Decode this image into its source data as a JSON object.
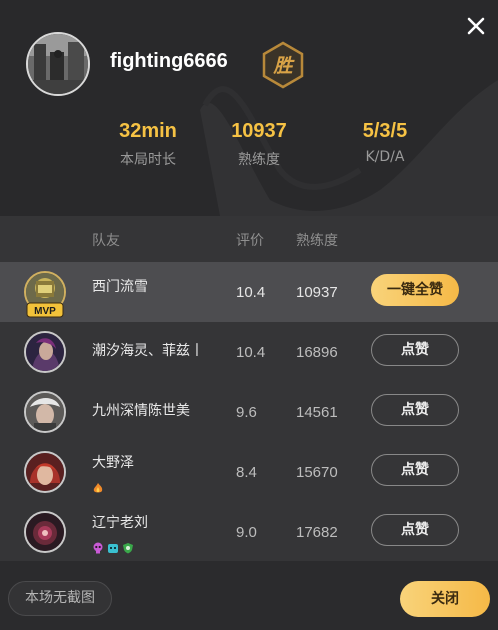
{
  "header": {
    "username": "fighting6666",
    "result_badge": "胜",
    "stats": [
      {
        "value": "32min",
        "label": "本局时长"
      },
      {
        "value": "10937",
        "label": "熟练度"
      },
      {
        "value": "5/3/5",
        "label": "K/D/A"
      }
    ]
  },
  "table": {
    "columns": {
      "teammate": "队友",
      "rating": "评价",
      "proficiency": "熟练度"
    },
    "rows": [
      {
        "name": "西门流雪",
        "rating": "10.4",
        "proficiency": "10937",
        "action": "一键全赞",
        "mvp": "MVP"
      },
      {
        "name": "潮汐海灵、菲兹丨",
        "rating": "10.4",
        "proficiency": "16896",
        "action": "点赞"
      },
      {
        "name": "九州深情陈世美",
        "rating": "9.6",
        "proficiency": "14561",
        "action": "点赞"
      },
      {
        "name": "大野泽",
        "rating": "8.4",
        "proficiency": "15670",
        "action": "点赞"
      },
      {
        "name": "辽宁老刘",
        "rating": "9.0",
        "proficiency": "17682",
        "action": "点赞"
      }
    ]
  },
  "footer": {
    "no_screenshot_label": "本场无截图",
    "close_label": "关闭"
  },
  "colors": {
    "accent_gold": "#f6c244",
    "button_gold": "#f5b947",
    "highlight_row": "#4d4d50"
  }
}
